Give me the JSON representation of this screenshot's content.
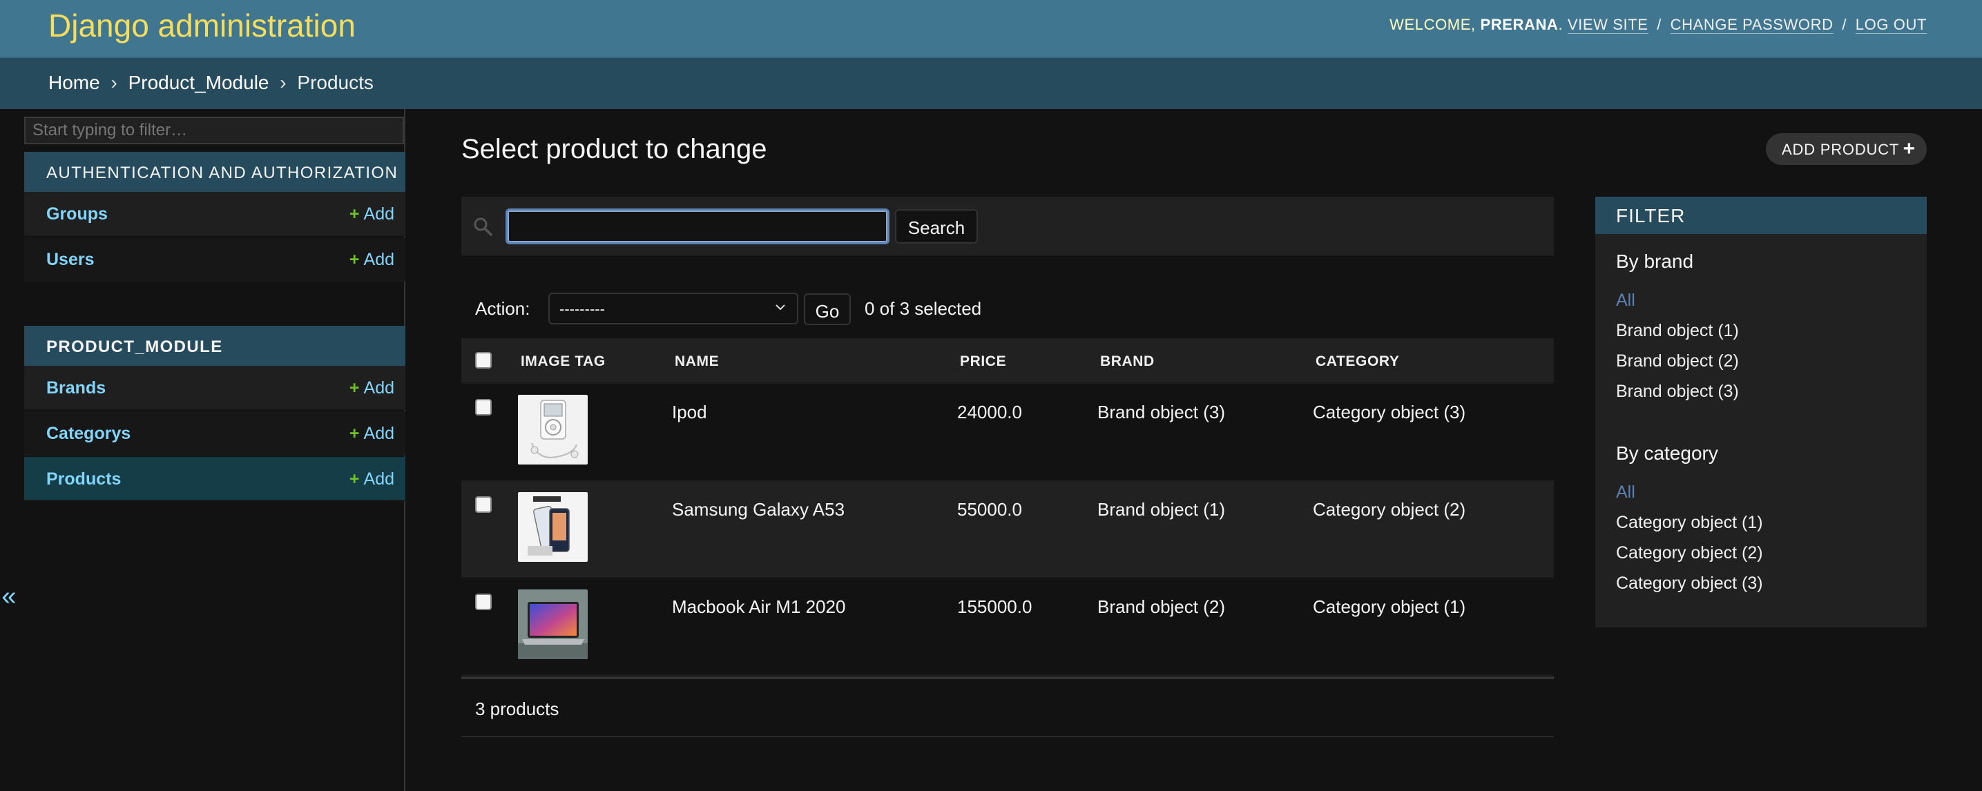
{
  "header": {
    "brand": "Django administration",
    "welcome": "WELCOME,",
    "username": "PRERANA",
    "period": ".",
    "view_site": "VIEW SITE",
    "change_password": "CHANGE PASSWORD",
    "log_out": "LOG OUT",
    "separator": "/"
  },
  "breadcrumbs": {
    "home": "Home",
    "module": "Product_Module",
    "current": "Products",
    "arrow": "›"
  },
  "sidebar": {
    "filter_placeholder": "Start typing to filter…",
    "modules": [
      {
        "caption": "AUTHENTICATION AND AUTHORIZATION",
        "models": [
          {
            "name": "Groups",
            "add": "Add"
          },
          {
            "name": "Users",
            "add": "Add"
          }
        ]
      },
      {
        "caption": "PRODUCT_MODULE",
        "models": [
          {
            "name": "Brands",
            "add": "Add"
          },
          {
            "name": "Categorys",
            "add": "Add"
          },
          {
            "name": "Products",
            "add": "Add"
          }
        ]
      }
    ],
    "collapse_glyph": "«"
  },
  "content": {
    "title": "Select product to change",
    "add_button": "ADD PRODUCT",
    "add_button_icon": "plus-icon",
    "search_button": "Search",
    "search_value": "",
    "action_label": "Action:",
    "action_selected": "---------",
    "go_button": "Go",
    "selected_count": "0 of 3 selected",
    "columns": [
      "IMAGE TAG",
      "NAME",
      "PRICE",
      "BRAND",
      "CATEGORY"
    ],
    "rows": [
      {
        "name": "Ipod",
        "price": "24000.0",
        "brand": "Brand object (3)",
        "category": "Category object (3)",
        "image_icon": "ipod-thumbnail"
      },
      {
        "name": "Samsung Galaxy A53",
        "price": "55000.0",
        "brand": "Brand object (1)",
        "category": "Category object (2)",
        "image_icon": "phone-thumbnail"
      },
      {
        "name": "Macbook Air M1 2020",
        "price": "155000.0",
        "brand": "Brand object (2)",
        "category": "Category object (1)",
        "image_icon": "laptop-thumbnail"
      }
    ],
    "result_count": "3 products"
  },
  "filter": {
    "header": "FILTER",
    "groups": [
      {
        "title": "By brand",
        "options": [
          "All",
          "Brand object (1)",
          "Brand object (2)",
          "Brand object (3)"
        ],
        "selected": "All"
      },
      {
        "title": "By category",
        "options": [
          "All",
          "Category object (1)",
          "Category object (2)",
          "Category object (3)"
        ],
        "selected": "All"
      }
    ]
  },
  "colors": {
    "header_bg": "#417690",
    "brand_yellow": "#f5dd5d",
    "caption_bg": "#264b5d",
    "link_blue": "#81d4fa",
    "add_green": "#70bf2b",
    "page_bg": "#121212"
  }
}
